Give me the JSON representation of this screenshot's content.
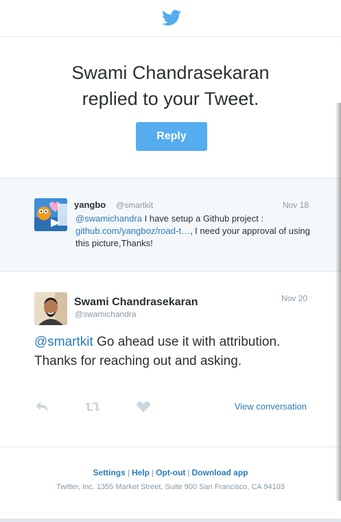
{
  "header": {
    "logo_icon": "twitter-bird-icon",
    "brand_color": "#55acee"
  },
  "hero": {
    "title_line1": "Swami Chandrasekaran",
    "title_line2": "replied to your Tweet.",
    "reply_button_label": "Reply"
  },
  "original_tweet": {
    "name": "yangbo",
    "handle": "@smartkit",
    "date": "Nov 18",
    "mention": "@swamichandra",
    "text_part1": " I have setup a Github project : ",
    "link": "github.com/yangboz/road-t…",
    "text_part2": ", I need your approval of using this picture,Thanks!"
  },
  "reply_tweet": {
    "name": "Swami Chandrasekaran",
    "handle": "@swamichandra",
    "date": "Nov 20",
    "mention": "@smartkit",
    "text": " Go ahead use it with attribution. Thanks for reaching out and asking.",
    "view_conversation": "View conversation"
  },
  "footer": {
    "links": [
      "Settings",
      "Help",
      "Opt-out",
      "Download app"
    ],
    "separator": "|",
    "address": "Twitter, Inc. 1355 Market Street, Suite 900 San Francisco, CA 94103"
  }
}
